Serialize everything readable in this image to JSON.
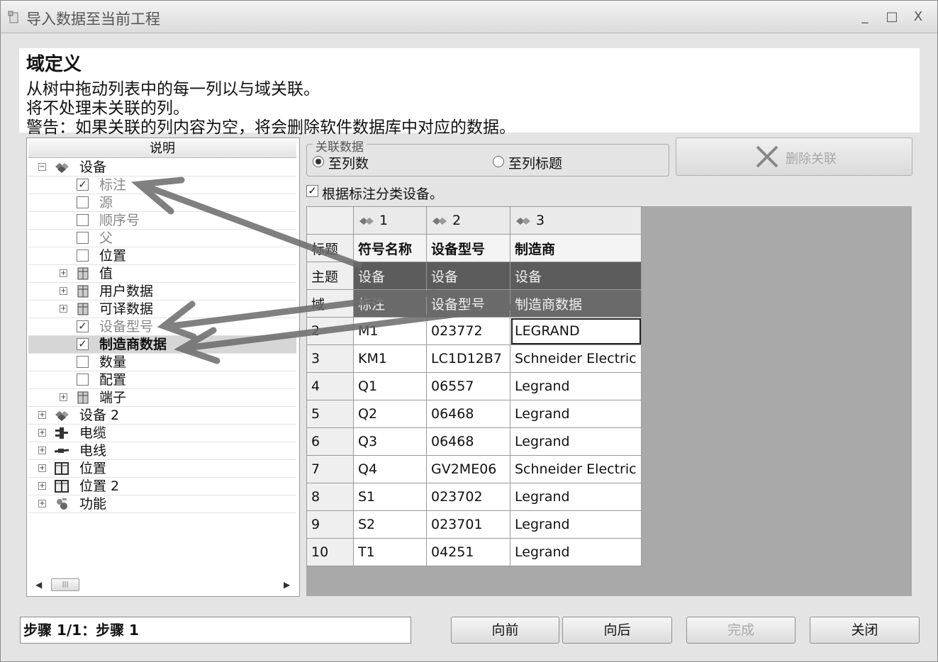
{
  "window": {
    "title": "导入数据至当前工程",
    "controls": {
      "minimize": "_",
      "maximize": "□",
      "close": "X"
    }
  },
  "header": {
    "title": "域定义",
    "lines": [
      "从树中拖动列表中的每一列以与域关联。",
      "将不处理未关联的列。",
      "警告：如果关联的列内容为空，将会删除软件数据库中对应的数据。"
    ]
  },
  "tree": {
    "column_header": "说明",
    "items": [
      {
        "label": "设备",
        "type": "node",
        "icon": "equipment-icon",
        "expanded": true
      },
      {
        "label": "标注",
        "type": "leaf",
        "checked": true,
        "style": "gray"
      },
      {
        "label": "源",
        "type": "leaf",
        "checked": false,
        "style": "gray"
      },
      {
        "label": "顺序号",
        "type": "leaf",
        "checked": false,
        "style": "gray"
      },
      {
        "label": "父",
        "type": "leaf",
        "checked": false,
        "style": "gray"
      },
      {
        "label": "位置",
        "type": "leaf",
        "checked": false,
        "style": "normal"
      },
      {
        "label": "值",
        "type": "sub",
        "icon": "table-icon"
      },
      {
        "label": "用户数据",
        "type": "sub",
        "icon": "table-icon"
      },
      {
        "label": "可译数据",
        "type": "sub",
        "icon": "table-icon"
      },
      {
        "label": "设备型号",
        "type": "leaf",
        "checked": true,
        "style": "gray"
      },
      {
        "label": "制造商数据",
        "type": "leaf",
        "checked": true,
        "style": "bold",
        "selected": true
      },
      {
        "label": "数量",
        "type": "leaf",
        "checked": false,
        "style": "normal"
      },
      {
        "label": "配置",
        "type": "leaf",
        "checked": false,
        "style": "normal"
      },
      {
        "label": "端子",
        "type": "sub",
        "icon": "table-icon"
      },
      {
        "label": "设备 2",
        "type": "node",
        "icon": "equipment-icon"
      },
      {
        "label": "电缆",
        "type": "node",
        "icon": "cable-icon"
      },
      {
        "label": "电线",
        "type": "node",
        "icon": "wire-icon"
      },
      {
        "label": "位置",
        "type": "node",
        "icon": "location-icon"
      },
      {
        "label": "位置 2",
        "type": "node",
        "icon": "location-icon"
      },
      {
        "label": "功能",
        "type": "node",
        "icon": "function-icon"
      }
    ]
  },
  "link_group": {
    "legend": "关联数据",
    "option_columns": "至列数",
    "option_titles": "至列标题",
    "selected": "至列数"
  },
  "delete_button": {
    "label": "删除关联",
    "enabled": false
  },
  "classify": {
    "label": "根据标注分类设备。",
    "checked": true
  },
  "grid": {
    "columns": [
      "1",
      "2",
      "3"
    ],
    "title_row": {
      "label": "标题",
      "values": [
        "符号名称",
        "设备型号",
        "制造商"
      ]
    },
    "subject_row": {
      "label": "主题",
      "values": [
        "设备",
        "设备",
        "设备"
      ]
    },
    "domain_row": {
      "label": "域",
      "values": [
        "标注",
        "设备型号",
        "制造商数据"
      ]
    },
    "rows": [
      {
        "n": "2",
        "c1": "M1",
        "c2": "023772",
        "c3": "LEGRAND"
      },
      {
        "n": "3",
        "c1": "KM1",
        "c2": "LC1D12B7",
        "c3": "Schneider Electric"
      },
      {
        "n": "4",
        "c1": "Q1",
        "c2": "06557",
        "c3": "Legrand"
      },
      {
        "n": "5",
        "c1": "Q2",
        "c2": "06468",
        "c3": "Legrand"
      },
      {
        "n": "6",
        "c1": "Q3",
        "c2": "06468",
        "c3": "Legrand"
      },
      {
        "n": "7",
        "c1": "Q4",
        "c2": "GV2ME06",
        "c3": "Schneider Electric"
      },
      {
        "n": "8",
        "c1": "S1",
        "c2": "023702",
        "c3": "Legrand"
      },
      {
        "n": "9",
        "c1": "S2",
        "c2": "023701",
        "c3": "Legrand"
      },
      {
        "n": "10",
        "c1": "T1",
        "c2": "04251",
        "c3": "Legrand"
      }
    ]
  },
  "status": {
    "text": "步骤 1/1：步骤 1"
  },
  "buttons": {
    "back": "向前",
    "next": "向后",
    "finish": "完成",
    "close": "关闭"
  }
}
